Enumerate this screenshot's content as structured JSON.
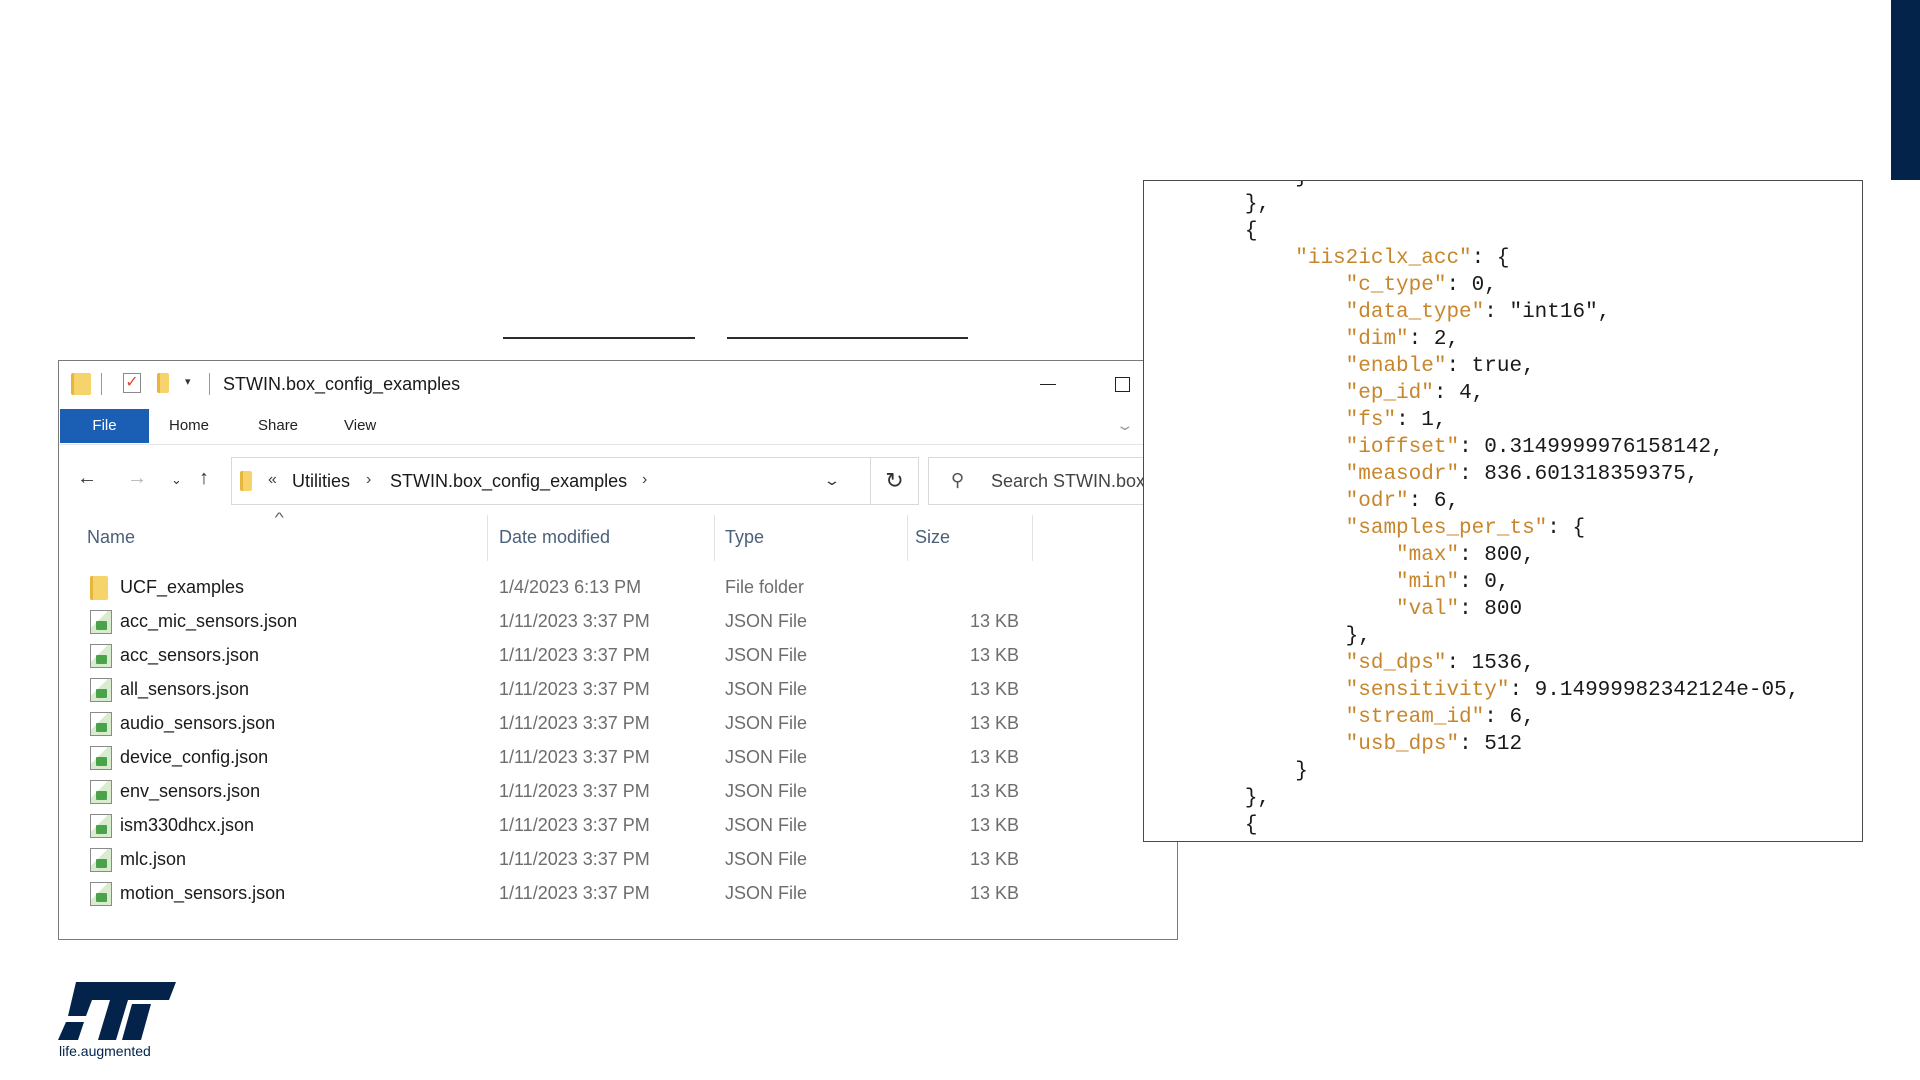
{
  "explorer": {
    "title": "STWIN.box_config_examples",
    "ribbon_tabs": [
      "File",
      "Home",
      "Share",
      "View"
    ],
    "breadcrumb": [
      "Utilities",
      "STWIN.box_config_examples"
    ],
    "breadcrumb_overflow": "«",
    "search_placeholder": "Search STWIN.box_config_examples",
    "columns": [
      "Name",
      "Date modified",
      "Type",
      "Size"
    ],
    "files": [
      {
        "name": "UCF_examples",
        "date": "1/4/2023 6:13 PM",
        "type": "File folder",
        "size": "",
        "icon": "folder-icon"
      },
      {
        "name": "acc_mic_sensors.json",
        "date": "1/11/2023 3:37 PM",
        "type": "JSON File",
        "size": "13 KB",
        "icon": "json-file-icon"
      },
      {
        "name": "acc_sensors.json",
        "date": "1/11/2023 3:37 PM",
        "type": "JSON File",
        "size": "13 KB",
        "icon": "json-file-icon"
      },
      {
        "name": "all_sensors.json",
        "date": "1/11/2023 3:37 PM",
        "type": "JSON File",
        "size": "13 KB",
        "icon": "json-file-icon"
      },
      {
        "name": "audio_sensors.json",
        "date": "1/11/2023 3:37 PM",
        "type": "JSON File",
        "size": "13 KB",
        "icon": "json-file-icon"
      },
      {
        "name": "device_config.json",
        "date": "1/11/2023 3:37 PM",
        "type": "JSON File",
        "size": "13 KB",
        "icon": "json-file-icon"
      },
      {
        "name": "env_sensors.json",
        "date": "1/11/2023 3:37 PM",
        "type": "JSON File",
        "size": "13 KB",
        "icon": "json-file-icon"
      },
      {
        "name": "ism330dhcx.json",
        "date": "1/11/2023 3:37 PM",
        "type": "JSON File",
        "size": "13 KB",
        "icon": "json-file-icon"
      },
      {
        "name": "mlc.json",
        "date": "1/11/2023 3:37 PM",
        "type": "JSON File",
        "size": "13 KB",
        "icon": "json-file-icon"
      },
      {
        "name": "motion_sensors.json",
        "date": "1/11/2023 3:37 PM",
        "type": "JSON File",
        "size": "13 KB",
        "icon": "json-file-icon"
      }
    ]
  },
  "json_code": {
    "lines": [
      {
        "indent": 12,
        "key": "",
        "rest": "}"
      },
      {
        "indent": 8,
        "key": "",
        "rest": "},"
      },
      {
        "indent": 8,
        "key": "",
        "rest": "{"
      },
      {
        "indent": 12,
        "key": "\"iis2iclx_acc\"",
        "rest": ": {"
      },
      {
        "indent": 16,
        "key": "\"c_type\"",
        "rest": ": 0,"
      },
      {
        "indent": 16,
        "key": "\"data_type\"",
        "rest": ": \"int16\","
      },
      {
        "indent": 16,
        "key": "\"dim\"",
        "rest": ": 2,"
      },
      {
        "indent": 16,
        "key": "\"enable\"",
        "rest": ": true,"
      },
      {
        "indent": 16,
        "key": "\"ep_id\"",
        "rest": ": 4,"
      },
      {
        "indent": 16,
        "key": "\"fs\"",
        "rest": ": 1,"
      },
      {
        "indent": 16,
        "key": "\"ioffset\"",
        "rest": ": 0.3149999976158142,"
      },
      {
        "indent": 16,
        "key": "\"measodr\"",
        "rest": ": 836.601318359375,"
      },
      {
        "indent": 16,
        "key": "\"odr\"",
        "rest": ": 6,"
      },
      {
        "indent": 16,
        "key": "\"samples_per_ts\"",
        "rest": ": {"
      },
      {
        "indent": 20,
        "key": "\"max\"",
        "rest": ": 800,"
      },
      {
        "indent": 20,
        "key": "\"min\"",
        "rest": ": 0,"
      },
      {
        "indent": 20,
        "key": "\"val\"",
        "rest": ": 800"
      },
      {
        "indent": 16,
        "key": "",
        "rest": "},"
      },
      {
        "indent": 16,
        "key": "\"sd_dps\"",
        "rest": ": 1536,"
      },
      {
        "indent": 16,
        "key": "\"sensitivity\"",
        "rest": ": 9.14999982342124e-05,"
      },
      {
        "indent": 16,
        "key": "\"stream_id\"",
        "rest": ": 6,"
      },
      {
        "indent": 16,
        "key": "\"usb_dps\"",
        "rest": ": 512"
      },
      {
        "indent": 12,
        "key": "",
        "rest": "}"
      },
      {
        "indent": 8,
        "key": "",
        "rest": "},"
      },
      {
        "indent": 8,
        "key": "",
        "rest": "{"
      }
    ]
  },
  "logo": {
    "tagline": "life.augmented"
  },
  "colors": {
    "accent": "#1a5fb4",
    "json_key": "#c8862c",
    "brand_navy": "#03234b"
  }
}
